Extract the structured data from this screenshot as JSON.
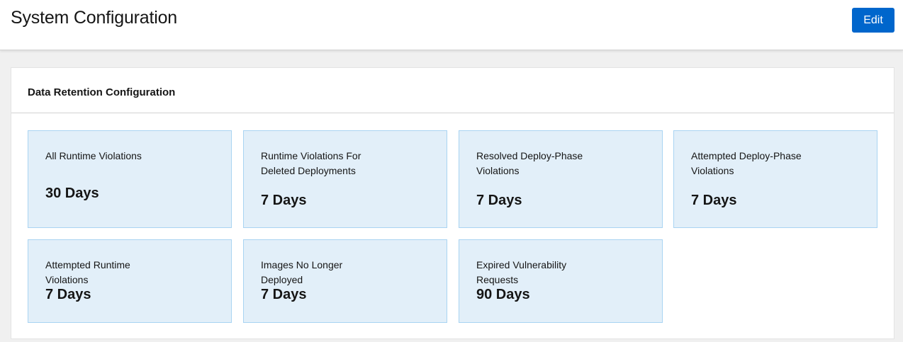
{
  "header": {
    "title": "System Configuration",
    "edit_label": "Edit"
  },
  "data_retention": {
    "title": "Data Retention Configuration",
    "tiles": [
      {
        "label": "All Runtime Violations",
        "value": "30 Days"
      },
      {
        "label": "Runtime Violations For Deleted Deployments",
        "value": "7 Days"
      },
      {
        "label": "Resolved Deploy-Phase Violations",
        "value": "7 Days"
      },
      {
        "label": "Attempted Deploy-Phase Violations",
        "value": "7 Days"
      },
      {
        "label": "Attempted Runtime Violations",
        "value": "7 Days"
      },
      {
        "label": "Images No Longer Deployed",
        "value": "7 Days"
      },
      {
        "label": "Expired Vulnerability Requests",
        "value": "90 Days"
      }
    ]
  },
  "colors": {
    "primary_button": "#0066cc",
    "tile_background": "#e2eff9",
    "tile_border": "#a9d4f2",
    "page_background": "#f0f0f0"
  }
}
